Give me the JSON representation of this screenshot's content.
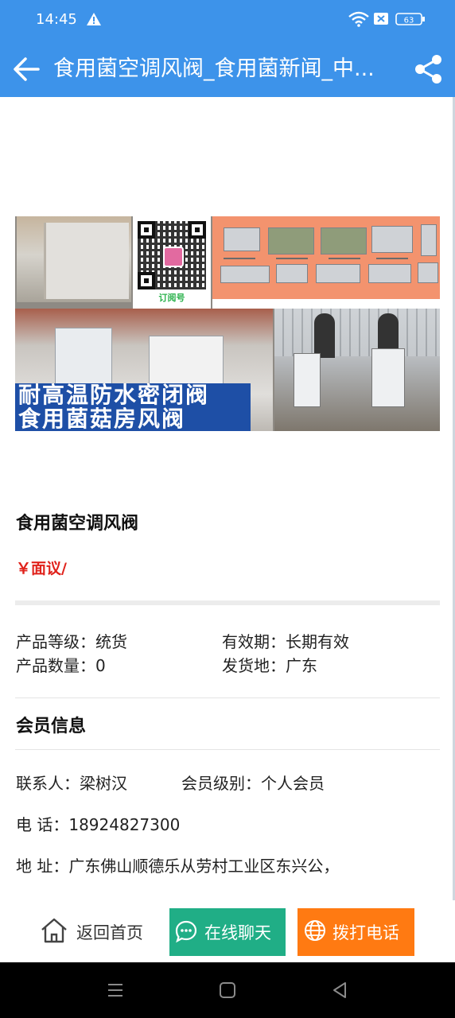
{
  "status_bar": {
    "time": "14:45",
    "battery": "63",
    "icons": [
      "warning-icon",
      "wifi-icon",
      "sim-off-icon",
      "battery-icon"
    ]
  },
  "app_bar": {
    "title": "食用菌空调风阀_食用菌新闻_中...",
    "icons": [
      "back-arrow-icon",
      "share-icon"
    ],
    "background": "#3d93ea"
  },
  "banner": {
    "qr_brand": "订阅号",
    "tagline_line1": "耐高温防水密闭阀",
    "tagline_line2": "食用菌菇房风阀"
  },
  "product": {
    "title": "食用菌空调风阀",
    "price": "￥面议/",
    "price_color": "#e0221b"
  },
  "specs": {
    "grade_label": "产品等级：",
    "grade_value": "统货",
    "validity_label": "有效期：",
    "validity_value": "长期有效",
    "quantity_label": "产品数量：",
    "quantity_value": "0",
    "ship_from_label": "发货地：",
    "ship_from_value": "广东"
  },
  "member": {
    "section_title": "会员信息",
    "contact_label": "联系人：",
    "contact_value": "梁树汉",
    "level_label": "会员级别：",
    "level_value": "个人会员",
    "phone_label": "电 话：",
    "phone_value": "18924827300",
    "address_label": "地 址：",
    "address_value": "广东佛山顺德乐从劳村工业区东兴公，"
  },
  "actions": {
    "home": "返回首页",
    "chat": "在线聊天",
    "call": "拨打电话",
    "chat_color": "#20ae86",
    "call_color": "#ff7a12"
  },
  "nav_bar": {
    "icons": [
      "menu-icon",
      "home-square-icon",
      "back-triangle-icon"
    ]
  }
}
